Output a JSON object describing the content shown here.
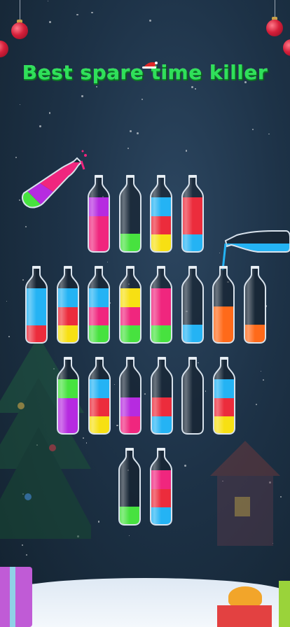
{
  "headline": "Best spare time killer",
  "colors": {
    "red": "#ec2c3c",
    "purple": "#b62be0",
    "green": "#47e23f",
    "blue": "#24b3f4",
    "yellow": "#f7e013",
    "pink": "#f0267e",
    "orange": "#ff6a1a",
    "headline": "#2fe05a"
  },
  "rows": [
    {
      "bottles": [
        [
          "pink",
          "pink",
          "purple"
        ],
        [
          "green"
        ],
        [
          "yellow",
          "red",
          "blue"
        ],
        [
          "blue",
          "red",
          "red"
        ]
      ]
    },
    {
      "bottles": [
        [
          "red",
          "blue",
          "blue"
        ],
        [
          "yellow",
          "red",
          "blue"
        ],
        [
          "green",
          "pink",
          "blue"
        ],
        [
          "green",
          "pink",
          "yellow"
        ],
        [
          "green",
          "pink",
          "pink"
        ],
        [
          "blue"
        ],
        [
          "orange",
          "orange"
        ],
        [
          "orange"
        ]
      ]
    },
    {
      "bottles": [
        [
          "purple",
          "purple",
          "green"
        ],
        [
          "yellow",
          "red",
          "blue"
        ],
        [
          "pink",
          "purple"
        ],
        [
          "blue",
          "red"
        ],
        [],
        [
          "yellow",
          "red",
          "blue"
        ]
      ]
    },
    {
      "bottles": [
        [
          "green"
        ],
        [
          "blue",
          "red",
          "pink"
        ]
      ]
    }
  ],
  "pouring_left": [
    "green",
    "purple",
    "pink"
  ],
  "pouring_right": [
    "blue"
  ],
  "icons": [
    "ornament-icon",
    "santa-hat-icon",
    "christmas-tree-icon",
    "gift-icon"
  ]
}
